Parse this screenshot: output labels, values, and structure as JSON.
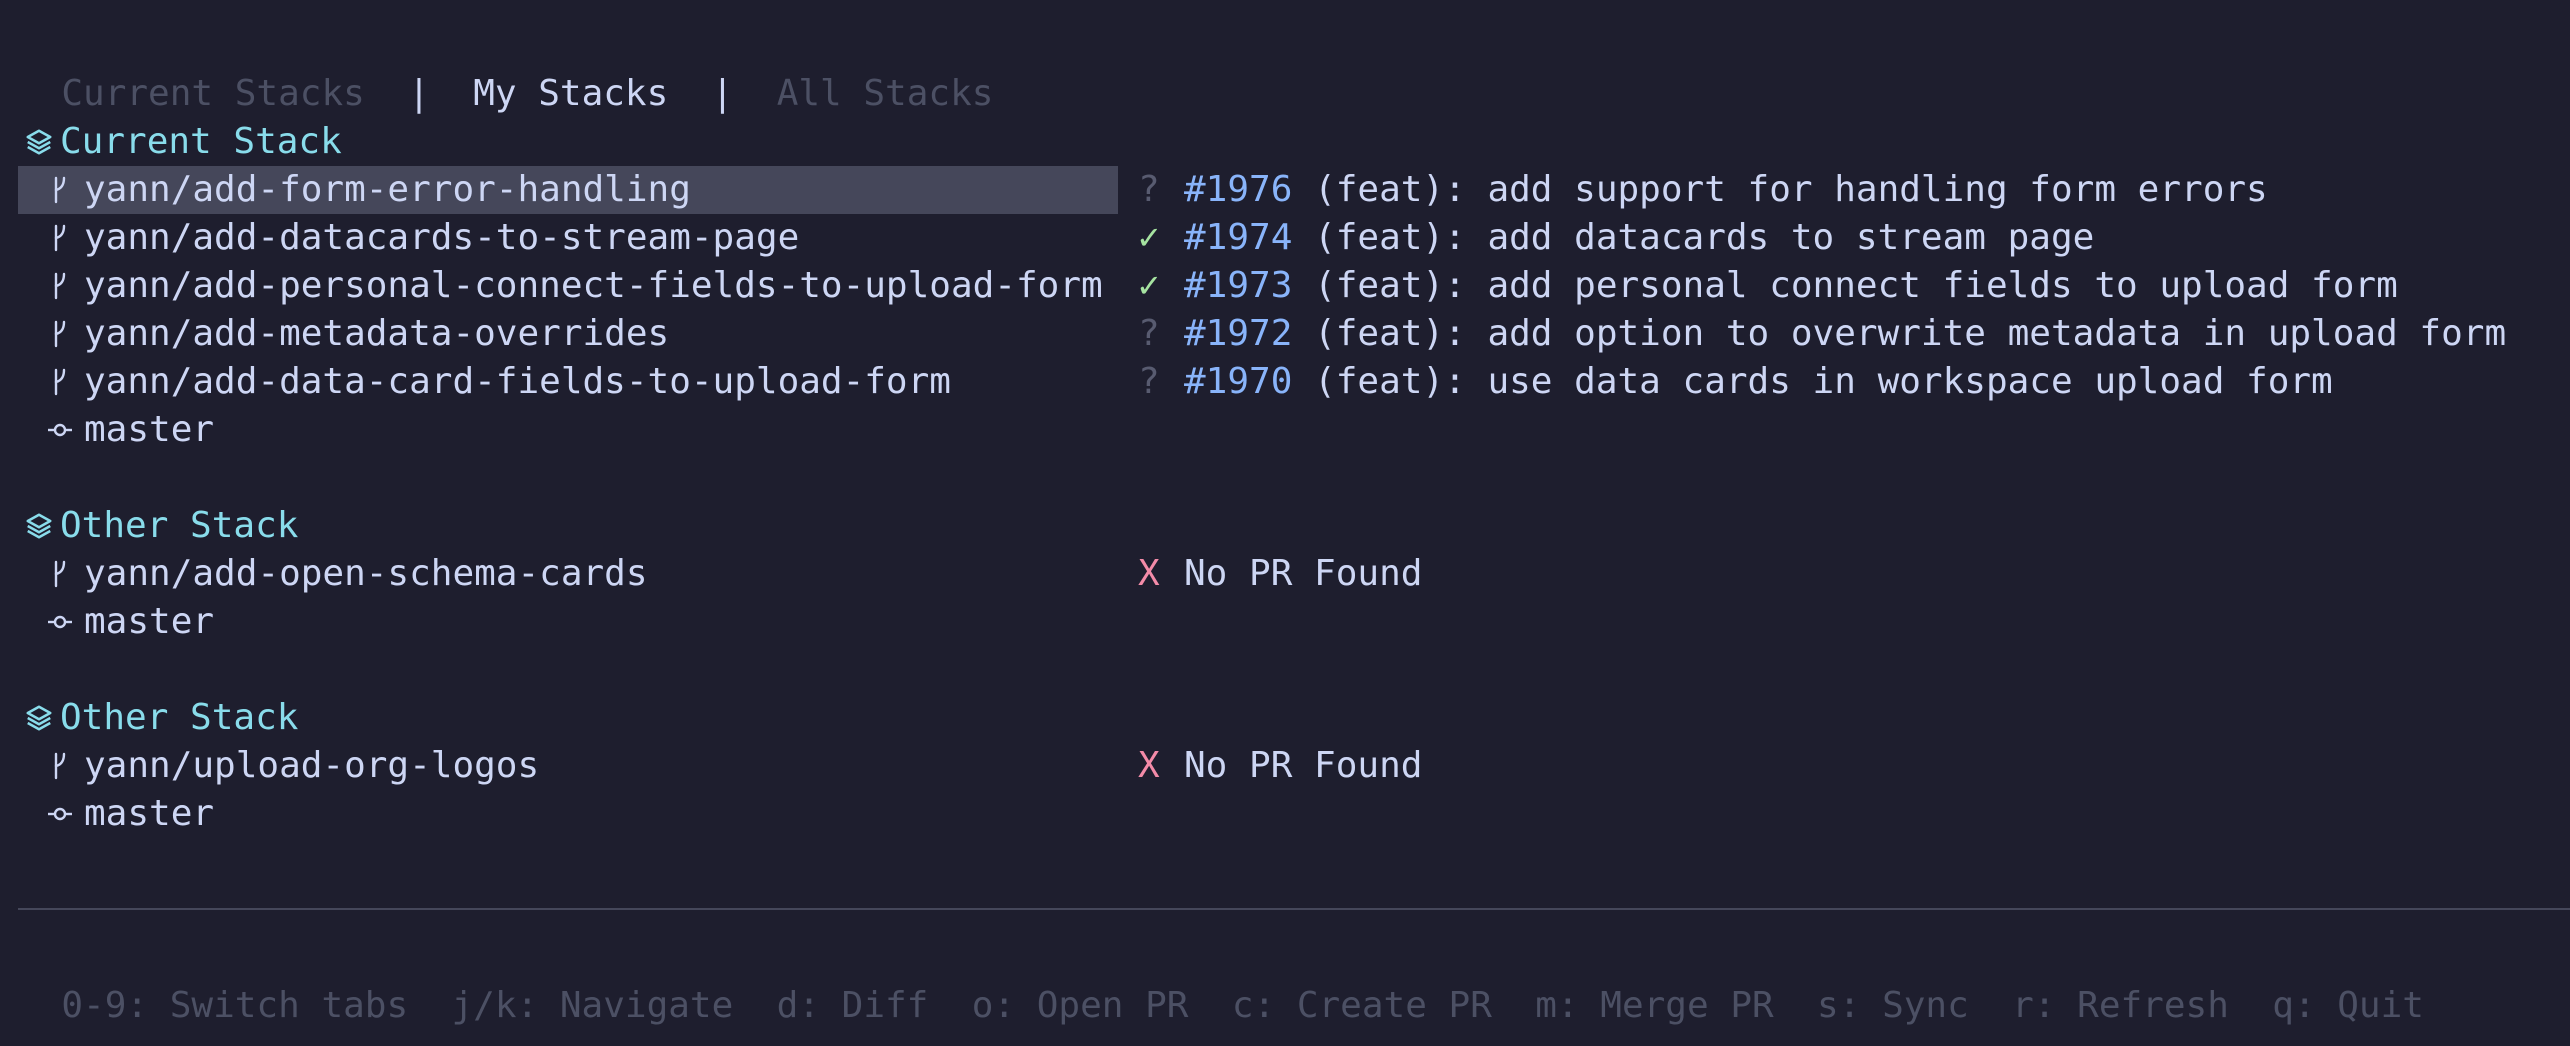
{
  "tabs": [
    {
      "label": "Current Stacks",
      "active": false
    },
    {
      "label": "My Stacks",
      "active": true
    },
    {
      "label": "All Stacks",
      "active": false
    }
  ],
  "tab_separator": "|",
  "stacks": [
    {
      "title": "Current Stack",
      "branches": [
        {
          "name": "yann/add-form-error-handling",
          "status": "?",
          "pr_number": "#1976",
          "pr_title": "(feat): add support for handling form errors",
          "selected": true
        },
        {
          "name": "yann/add-datacards-to-stream-page",
          "status": "✓",
          "pr_number": "#1974",
          "pr_title": "(feat): add datacards to stream page"
        },
        {
          "name": "yann/add-personal-connect-fields-to-upload-form",
          "status": "✓",
          "pr_number": "#1973",
          "pr_title": "(feat): add personal connect fields to upload form"
        },
        {
          "name": "yann/add-metadata-overrides",
          "status": "?",
          "pr_number": "#1972",
          "pr_title": "(feat): add option to overwrite metadata in upload form"
        },
        {
          "name": "yann/add-data-card-fields-to-upload-form",
          "status": "?",
          "pr_number": "#1970",
          "pr_title": "(feat): use data cards in workspace upload form"
        }
      ],
      "base": "master"
    },
    {
      "title": "Other Stack",
      "branches": [
        {
          "name": "yann/add-open-schema-cards",
          "status": "X",
          "pr_text": "No PR Found"
        }
      ],
      "base": "master"
    },
    {
      "title": "Other Stack",
      "branches": [
        {
          "name": "yann/upload-org-logos",
          "status": "X",
          "pr_text": "No PR Found"
        }
      ],
      "base": "master"
    }
  ],
  "footer": {
    "hints": [
      "0-9: Switch tabs",
      "j/k: Navigate",
      "d: Diff",
      "o: Open PR",
      "c: Create PR",
      "m: Merge PR",
      "s: Sync",
      "r: Refresh",
      "q: Quit"
    ]
  },
  "colors": {
    "background": "#1e1e2e",
    "text": "#cdd6f4",
    "stack_header": "#89dceb",
    "pr_number": "#89b4fa",
    "status_ok": "#a6e3a1",
    "status_missing": "#f38ba8",
    "status_unknown": "#585b70",
    "selected_row": "#45475a",
    "muted": "#4c5064"
  }
}
